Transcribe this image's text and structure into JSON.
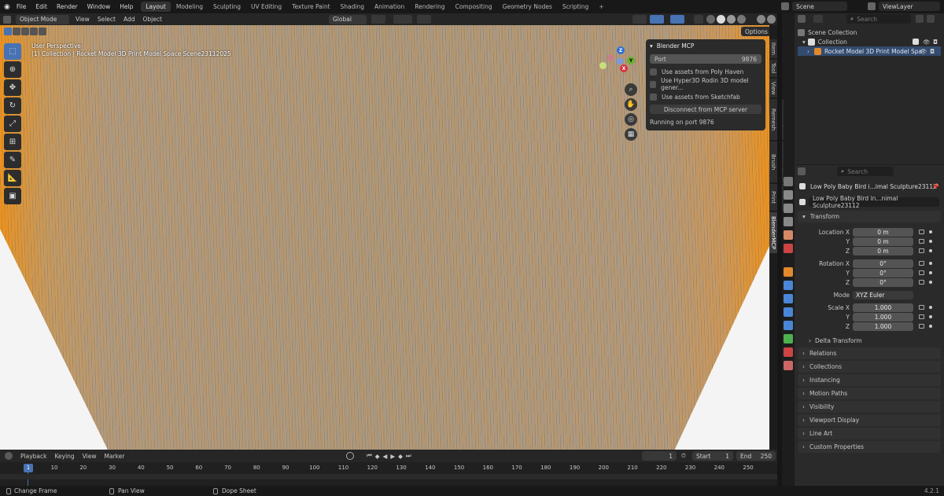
{
  "menu": [
    "File",
    "Edit",
    "Render",
    "Window",
    "Help"
  ],
  "workspaces": [
    "Layout",
    "Modeling",
    "Sculpting",
    "UV Editing",
    "Texture Paint",
    "Shading",
    "Animation",
    "Rendering",
    "Compositing",
    "Geometry Nodes",
    "Scripting"
  ],
  "add_ws": "+",
  "scene": "Scene",
  "view_layer": "ViewLayer",
  "vp_header": {
    "mode": "Object Mode",
    "items": [
      "View",
      "Select",
      "Add",
      "Object"
    ],
    "transform": "Global",
    "options": "Options"
  },
  "overlay_text": {
    "line1": "User Perspective",
    "line2": "(1) Collection | Rocket Model 3D Print Model Space Scene23112025"
  },
  "mcp": {
    "title": "Blender MCP",
    "port_label": "Port",
    "port_value": "9876",
    "chk1": "Use assets from Poly Haven",
    "chk2": "Use Hyper3D Rodin 3D model gener...",
    "chk3": "Use assets from Sketchfab",
    "disconnect": "Disconnect from MCP server",
    "status": "Running on port 9876"
  },
  "side_tabs": [
    "Item",
    "Tool",
    "View",
    "Quad Remesh",
    "3D Hair Brush",
    "3D Print",
    "BlenderMCP"
  ],
  "gizmo": {
    "x": "X",
    "y": "Y",
    "z": "Z"
  },
  "outliner": {
    "search": "Search",
    "root": "Scene Collection",
    "collection": "Collection",
    "object": "Rocket Model 3D Print Model Spa"
  },
  "props": {
    "search": "Search",
    "object_name": "Low Poly Baby Bird i...imal Sculpture23112",
    "data_name": "Low Poly Baby Bird in...nimal Sculpture23112",
    "transform": "Transform",
    "location": {
      "label": "Location X",
      "x": "0 m",
      "y": "0 m",
      "z": "0 m"
    },
    "rotation": {
      "label": "Rotation X",
      "x": "0°",
      "y": "0°",
      "z": "0°"
    },
    "mode_label": "Mode",
    "mode": "XYZ Euler",
    "scale": {
      "label": "Scale X",
      "x": "1.000",
      "y": "1.000",
      "z": "1.000"
    },
    "axis_y": "Y",
    "axis_z": "Z",
    "delta": "Delta Transform",
    "sections": [
      "Relations",
      "Collections",
      "Instancing",
      "Motion Paths",
      "Visibility",
      "Viewport Display",
      "Line Art",
      "Custom Properties"
    ]
  },
  "timeline": {
    "playback": "Playback",
    "keying": "Keying",
    "view": "View",
    "marker": "Marker",
    "current": "1",
    "start_label": "Start",
    "start": "1",
    "end_label": "End",
    "end": "250"
  },
  "ticks": [
    "1",
    "10",
    "20",
    "30",
    "40",
    "50",
    "60",
    "70",
    "80",
    "90",
    "100",
    "110",
    "120",
    "130",
    "140",
    "150",
    "160",
    "170",
    "180",
    "190",
    "200",
    "210",
    "220",
    "230",
    "240",
    "250"
  ],
  "status": {
    "left": "Change Frame",
    "mid": "Pan View",
    "right": "Dope Sheet",
    "version": "4.2.1"
  }
}
